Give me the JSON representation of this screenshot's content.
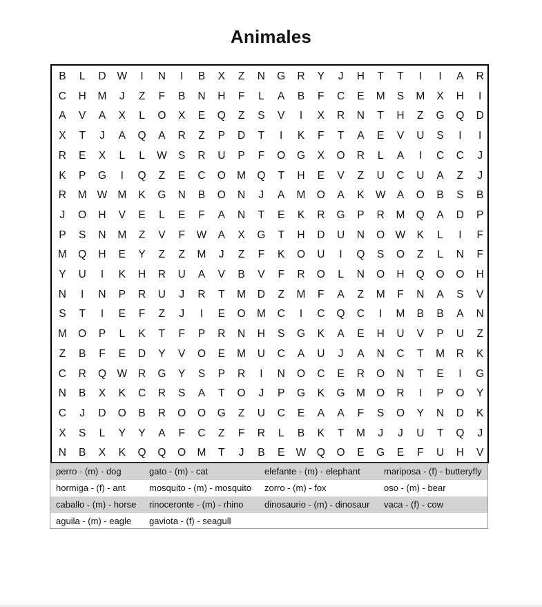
{
  "title": "Animales",
  "grid_rows": [
    "BLDWINIBXZNGRYJHTTIIAR",
    "CHMJZFBNHFLABFCEMSMXHI",
    "AVAXLOXEQZSVIXRNTHZGQD",
    "XTJAQARZPDTIKFTAEVUSII",
    "REXLLWSRUPFOGXORLAICCJ",
    "KPGIQZECOMQTHEVZUCUAZJ",
    "RMWMKGNBONJAMOAKWAOBSB",
    "JOHVELEFANTEKRGPRMQADP",
    "PSNMZVFWAXGTHDUNOWKLIF",
    "MQHEYZZMJZFKOUIQSOZLNF",
    "YUIKHRUAVBVFROLNOHQOOH",
    "NINPRUJRTMDZMFAZMFNASV",
    "STIEFZJIEOMCICQCIMBBAN",
    "MOPLKTFPRNHSGKAEHUVPUZ",
    "ZBFEDYVOEMUCAUJANCTMRK",
    "CRQWRGYSPRINOCERONTEIG",
    "NBXKCRSATOJPGKGMORIPOY",
    "CJDOBROOGZUCEAAFSOYNDK",
    "XSLYYAFCZFRLBKTMJJUTQJ",
    "NBXKQQOMTJBEWQOEGEFUHV"
  ],
  "word_list": [
    [
      "perro - (m) - dog",
      "gato - (m) - cat",
      "elefante - (m) - elephant",
      "mariposa - (f) - butteryfly"
    ],
    [
      "hormiga - (f) - ant",
      "mosquito - (m) - mosquito",
      "zorro - (m) - fox",
      "oso - (m) - bear"
    ],
    [
      "caballo - (m) - horse",
      "rinoceronte - (m) - rhino",
      "dinosaurio - (m) - dinosaur",
      "vaca - (f) - cow"
    ],
    [
      "aguila - (m) - eagle",
      "gaviota - (f) - seagull",
      "",
      ""
    ]
  ]
}
